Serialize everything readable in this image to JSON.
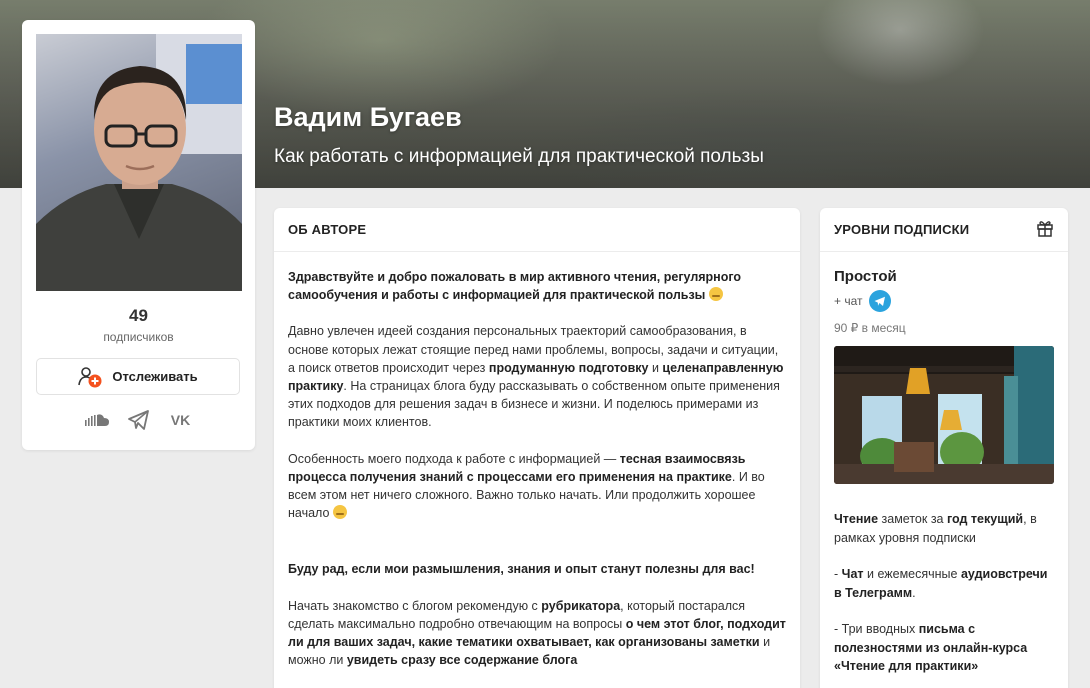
{
  "hero": {
    "title": "Вадим Бугаев",
    "subtitle": "Как работать с информацией для практической пользы"
  },
  "profile": {
    "subscribers_count": "49",
    "subscribers_label": "подписчиков",
    "follow_label": "Отслеживать",
    "socials": [
      "soundcloud-icon",
      "telegram-icon",
      "vk-icon"
    ],
    "vk_text": "VK"
  },
  "about": {
    "header": "ОБ АВТОРЕ",
    "p1_bold": "Здравствуйте и добро пожаловать в мир активного чтения, регулярного самообучения и работы с информацией для практической пользы",
    "p2_a": "Давно увлечен идеей создания персональных траекторий самообразования, в основе которых лежат стоящие перед нами проблемы, вопросы, задачи и ситуации, а поиск ответов происходит через",
    "p2_b1": "продуманную подготовку",
    "p2_c": "и",
    "p2_b2": "целенаправленную практику",
    "p2_d": ". На страницах блога буду рассказывать о собственном опыте применения этих подходов для решения задач в бизнесе и жизни. И поделюсь примерами из практики моих клиентов.",
    "p3_a": "Особенность моего подхода к работе с информацией —",
    "p3_b": "тесная взаимосвязь процесса получения знаний с процессами его применения на практике",
    "p3_c": ". И во всем этом нет ничего сложного. Важно только начать. Или продолжить хорошее начало",
    "p4_bold": "Буду рад, если мои размышления, знания и опыт станут полезны для вас!",
    "p5_a": "Начать знакомство с блогом рекомендую с",
    "p5_b1": "рубрикатора",
    "p5_c": ", который постарался сделать максимально подробно отвечающим на вопросы",
    "p5_b2": "о чем этот блог, подходит ли для ваших задач, какие тематики охватывает, как организованы заметки",
    "p5_d": "и можно ли",
    "p5_b3": "увидеть сразу все содержание блога"
  },
  "levels": {
    "header": "УРОВНИ ПОДПИСКИ",
    "name": "Простой",
    "chat": "+ чат",
    "price": "90 ₽ в месяц",
    "t1_b1": "Чтение",
    "t1_a": "заметок за",
    "t1_b2": "год текущий",
    "t1_c": ", в рамках уровня подписки",
    "t2_a": "-",
    "t2_b1": "Чат",
    "t2_c": "и ежемесячные",
    "t2_b2": "аудиовстречи в Телеграмм",
    "t2_d": ".",
    "t3_a": "- Три вводных",
    "t3_b": "письма с полезностями из онлайн-курса «Чтение для практики»"
  },
  "colors": {
    "accent_orange": "#f4511e",
    "telegram_blue": "#2aa3de",
    "page_bg": "#ececec"
  }
}
